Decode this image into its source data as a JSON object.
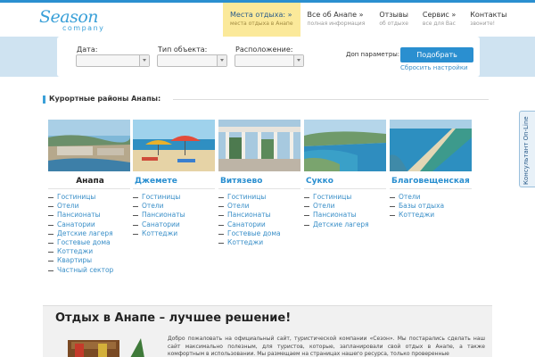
{
  "logo": {
    "line1": "Season",
    "line2": "company"
  },
  "nav": [
    {
      "title": "Места отдыха: »",
      "subtitle": "места отдыха в Анапе",
      "active": true
    },
    {
      "title": "Все об Анапе  »",
      "subtitle": "полная информация",
      "active": false
    },
    {
      "title": "Отзывы",
      "subtitle": "об отдыхе",
      "active": false
    },
    {
      "title": "Сервис  »",
      "subtitle": "все для Вас",
      "active": false
    },
    {
      "title": "Контакты",
      "subtitle": "звоните!",
      "active": false
    }
  ],
  "search": {
    "date_label": "Дата:",
    "type_label": "Тип объекта:",
    "location_label": "Расположение:",
    "extra_label": "Доп параметры:",
    "find_button": "Подобрать",
    "reset_link": "Сбросить настройки"
  },
  "consultant_tab": "Консультант On-Line",
  "section_title": "Курортные районы Анапы:",
  "districts": [
    {
      "name": "Анапа",
      "items": [
        "Гостиницы",
        "Отели",
        "Пансионаты",
        "Санатории",
        "Детские лагеря",
        "Гостевые дома",
        "Коттеджи",
        "Квартиры",
        "Частный сектор"
      ]
    },
    {
      "name": "Джемете",
      "items": [
        "Гостиницы",
        "Отели",
        "Пансионаты",
        "Санатории",
        "Коттеджи"
      ]
    },
    {
      "name": "Витязево",
      "items": [
        "Гостиницы",
        "Отели",
        "Пансионаты",
        "Санатории",
        "Гостевые дома",
        "Коттеджи"
      ]
    },
    {
      "name": "Сукко",
      "items": [
        "Гостиницы",
        "Отели",
        "Пансионаты",
        "Детские лагеря"
      ]
    },
    {
      "name": "Благовещенская",
      "items": [
        "Отели",
        "Базы отдыха",
        "Коттеджи"
      ]
    }
  ],
  "bottom": {
    "title": "Отдых в Анапе – лучшее решение!",
    "text": "Добро пожаловать на официальный сайт, туристической компании «Сезон». Мы постарались сделать наш сайт максимально полезным, для туристов, которые, запланировали свой отдых в Анапе, а также комфортным в использовании. Мы размещаем на страницах нашего ресурса, только проверенные"
  },
  "colors": {
    "accent": "#2a8fd0",
    "active_nav": "#fbe99a",
    "search_band": "#cfe3f1"
  }
}
